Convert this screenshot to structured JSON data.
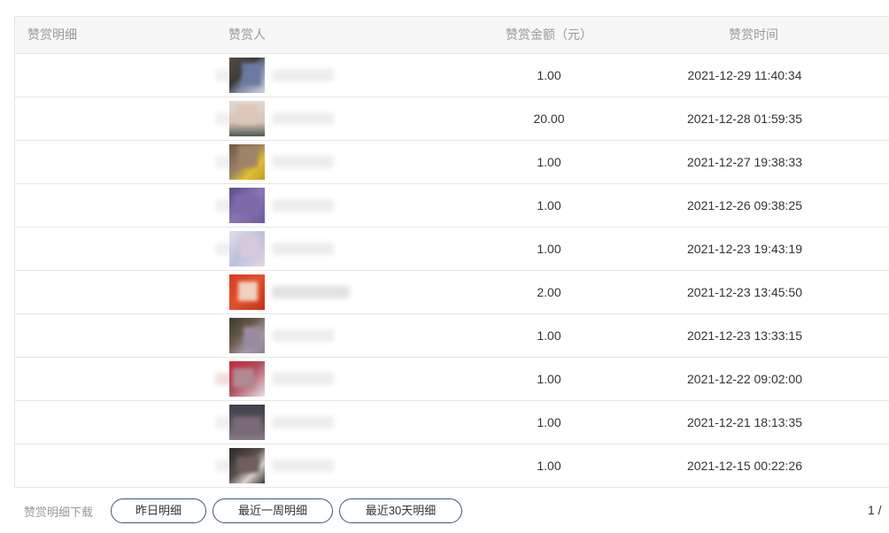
{
  "table": {
    "headers": {
      "detail": "赞赏明细",
      "user": "赞赏人",
      "amount": "赞赏金额（元）",
      "time": "赞赏时间"
    },
    "rows": [
      {
        "amount": "1.00",
        "time": "2021-12-29 11:40:34"
      },
      {
        "amount": "20.00",
        "time": "2021-12-28 01:59:35"
      },
      {
        "amount": "1.00",
        "time": "2021-12-27 19:38:33"
      },
      {
        "amount": "1.00",
        "time": "2021-12-26 09:38:25"
      },
      {
        "amount": "1.00",
        "time": "2021-12-23 19:43:19"
      },
      {
        "amount": "2.00",
        "time": "2021-12-23 13:45:50"
      },
      {
        "amount": "1.00",
        "time": "2021-12-23 13:33:15"
      },
      {
        "amount": "1.00",
        "time": "2021-12-22 09:02:00"
      },
      {
        "amount": "1.00",
        "time": "2021-12-21 18:13:35"
      },
      {
        "amount": "1.00",
        "time": "2021-12-15 00:22:26"
      }
    ]
  },
  "footer": {
    "download_label": "赞赏明细下载",
    "buttons": [
      "昨日明细",
      "最近一周明细",
      "最近30天明细"
    ],
    "pagination": "1 /"
  }
}
